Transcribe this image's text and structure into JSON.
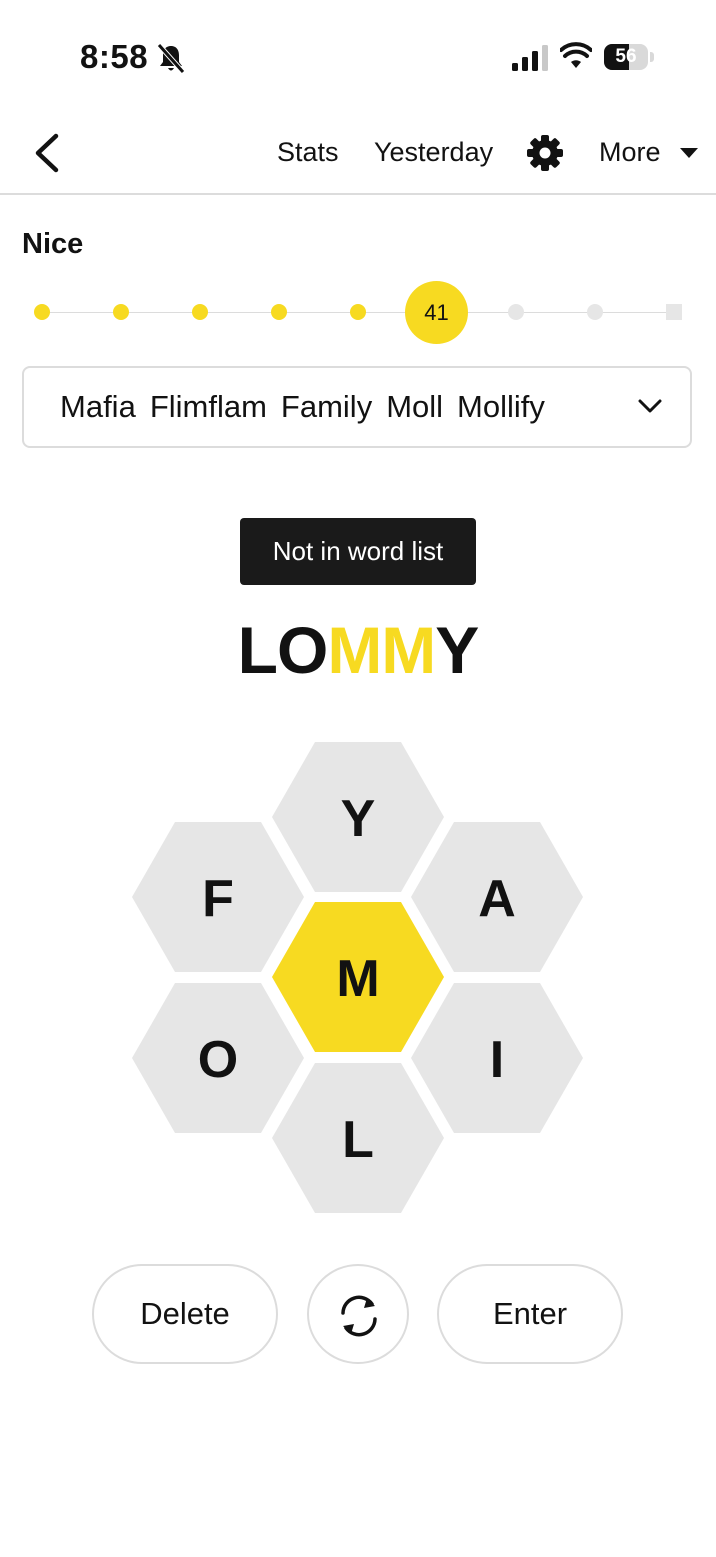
{
  "status_bar": {
    "time": "8:58",
    "battery": "56",
    "battery_level": 0.56
  },
  "nav": {
    "stats": "Stats",
    "yesterday": "Yesterday",
    "more": "More"
  },
  "progress": {
    "rank": "Nice",
    "score": "41",
    "levels_total": 9,
    "current_level_index": 5
  },
  "found_words": [
    "Mafia",
    "Flimflam",
    "Family",
    "Moll",
    "Mollify"
  ],
  "toast": "Not in word list",
  "input": {
    "prefix": "LO",
    "center": "MM",
    "suffix": "Y"
  },
  "hive": {
    "center": "M",
    "outer": {
      "top": "Y",
      "top_left": "F",
      "top_right": "A",
      "bottom_left": "O",
      "bottom_right": "I",
      "bottom": "L"
    }
  },
  "buttons": {
    "delete": "Delete",
    "enter": "Enter"
  },
  "colors": {
    "accent": "#f7da21",
    "cell": "#e6e6e6",
    "text": "#121212",
    "toast_bg": "#1a1a1a"
  }
}
